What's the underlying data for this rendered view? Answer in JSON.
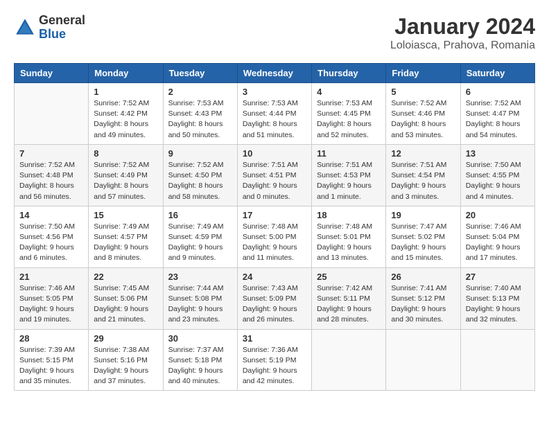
{
  "header": {
    "logo_general": "General",
    "logo_blue": "Blue",
    "title": "January 2024",
    "subtitle": "Loloiasca, Prahova, Romania"
  },
  "calendar": {
    "days_of_week": [
      "Sunday",
      "Monday",
      "Tuesday",
      "Wednesday",
      "Thursday",
      "Friday",
      "Saturday"
    ],
    "weeks": [
      [
        {
          "day": "",
          "info": ""
        },
        {
          "day": "1",
          "info": "Sunrise: 7:52 AM\nSunset: 4:42 PM\nDaylight: 8 hours\nand 49 minutes."
        },
        {
          "day": "2",
          "info": "Sunrise: 7:53 AM\nSunset: 4:43 PM\nDaylight: 8 hours\nand 50 minutes."
        },
        {
          "day": "3",
          "info": "Sunrise: 7:53 AM\nSunset: 4:44 PM\nDaylight: 8 hours\nand 51 minutes."
        },
        {
          "day": "4",
          "info": "Sunrise: 7:53 AM\nSunset: 4:45 PM\nDaylight: 8 hours\nand 52 minutes."
        },
        {
          "day": "5",
          "info": "Sunrise: 7:52 AM\nSunset: 4:46 PM\nDaylight: 8 hours\nand 53 minutes."
        },
        {
          "day": "6",
          "info": "Sunrise: 7:52 AM\nSunset: 4:47 PM\nDaylight: 8 hours\nand 54 minutes."
        }
      ],
      [
        {
          "day": "7",
          "info": "Sunrise: 7:52 AM\nSunset: 4:48 PM\nDaylight: 8 hours\nand 56 minutes."
        },
        {
          "day": "8",
          "info": "Sunrise: 7:52 AM\nSunset: 4:49 PM\nDaylight: 8 hours\nand 57 minutes."
        },
        {
          "day": "9",
          "info": "Sunrise: 7:52 AM\nSunset: 4:50 PM\nDaylight: 8 hours\nand 58 minutes."
        },
        {
          "day": "10",
          "info": "Sunrise: 7:51 AM\nSunset: 4:51 PM\nDaylight: 9 hours\nand 0 minutes."
        },
        {
          "day": "11",
          "info": "Sunrise: 7:51 AM\nSunset: 4:53 PM\nDaylight: 9 hours\nand 1 minute."
        },
        {
          "day": "12",
          "info": "Sunrise: 7:51 AM\nSunset: 4:54 PM\nDaylight: 9 hours\nand 3 minutes."
        },
        {
          "day": "13",
          "info": "Sunrise: 7:50 AM\nSunset: 4:55 PM\nDaylight: 9 hours\nand 4 minutes."
        }
      ],
      [
        {
          "day": "14",
          "info": "Sunrise: 7:50 AM\nSunset: 4:56 PM\nDaylight: 9 hours\nand 6 minutes."
        },
        {
          "day": "15",
          "info": "Sunrise: 7:49 AM\nSunset: 4:57 PM\nDaylight: 9 hours\nand 8 minutes."
        },
        {
          "day": "16",
          "info": "Sunrise: 7:49 AM\nSunset: 4:59 PM\nDaylight: 9 hours\nand 9 minutes."
        },
        {
          "day": "17",
          "info": "Sunrise: 7:48 AM\nSunset: 5:00 PM\nDaylight: 9 hours\nand 11 minutes."
        },
        {
          "day": "18",
          "info": "Sunrise: 7:48 AM\nSunset: 5:01 PM\nDaylight: 9 hours\nand 13 minutes."
        },
        {
          "day": "19",
          "info": "Sunrise: 7:47 AM\nSunset: 5:02 PM\nDaylight: 9 hours\nand 15 minutes."
        },
        {
          "day": "20",
          "info": "Sunrise: 7:46 AM\nSunset: 5:04 PM\nDaylight: 9 hours\nand 17 minutes."
        }
      ],
      [
        {
          "day": "21",
          "info": "Sunrise: 7:46 AM\nSunset: 5:05 PM\nDaylight: 9 hours\nand 19 minutes."
        },
        {
          "day": "22",
          "info": "Sunrise: 7:45 AM\nSunset: 5:06 PM\nDaylight: 9 hours\nand 21 minutes."
        },
        {
          "day": "23",
          "info": "Sunrise: 7:44 AM\nSunset: 5:08 PM\nDaylight: 9 hours\nand 23 minutes."
        },
        {
          "day": "24",
          "info": "Sunrise: 7:43 AM\nSunset: 5:09 PM\nDaylight: 9 hours\nand 26 minutes."
        },
        {
          "day": "25",
          "info": "Sunrise: 7:42 AM\nSunset: 5:11 PM\nDaylight: 9 hours\nand 28 minutes."
        },
        {
          "day": "26",
          "info": "Sunrise: 7:41 AM\nSunset: 5:12 PM\nDaylight: 9 hours\nand 30 minutes."
        },
        {
          "day": "27",
          "info": "Sunrise: 7:40 AM\nSunset: 5:13 PM\nDaylight: 9 hours\nand 32 minutes."
        }
      ],
      [
        {
          "day": "28",
          "info": "Sunrise: 7:39 AM\nSunset: 5:15 PM\nDaylight: 9 hours\nand 35 minutes."
        },
        {
          "day": "29",
          "info": "Sunrise: 7:38 AM\nSunset: 5:16 PM\nDaylight: 9 hours\nand 37 minutes."
        },
        {
          "day": "30",
          "info": "Sunrise: 7:37 AM\nSunset: 5:18 PM\nDaylight: 9 hours\nand 40 minutes."
        },
        {
          "day": "31",
          "info": "Sunrise: 7:36 AM\nSunset: 5:19 PM\nDaylight: 9 hours\nand 42 minutes."
        },
        {
          "day": "",
          "info": ""
        },
        {
          "day": "",
          "info": ""
        },
        {
          "day": "",
          "info": ""
        }
      ]
    ]
  }
}
